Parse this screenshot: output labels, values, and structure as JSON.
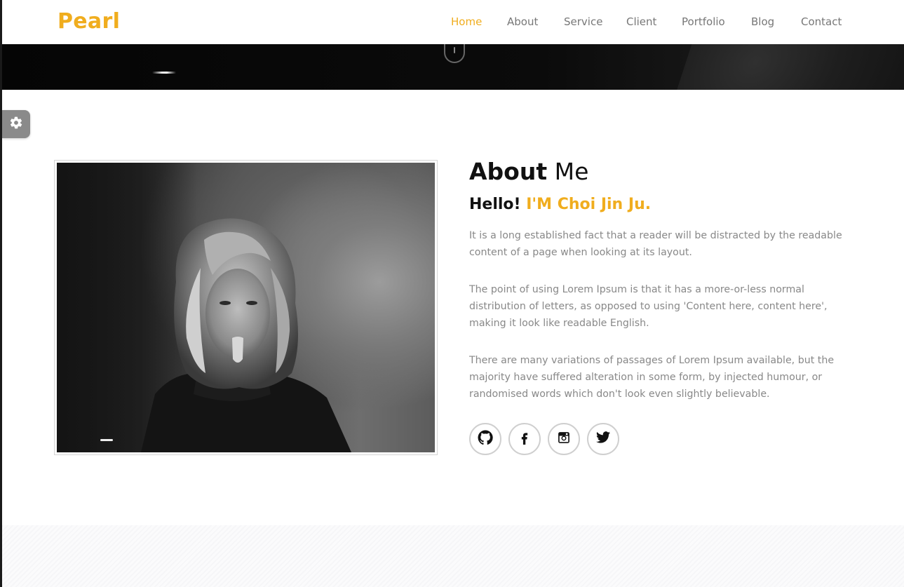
{
  "brand": {
    "name": "Pearl",
    "color": "#f0ad1e"
  },
  "nav": {
    "items": [
      {
        "label": "Home",
        "active": true
      },
      {
        "label": "About",
        "active": false
      },
      {
        "label": "Service",
        "active": false
      },
      {
        "label": "Client",
        "active": false
      },
      {
        "label": "Portfolio",
        "active": false
      },
      {
        "label": "Blog",
        "active": false
      },
      {
        "label": "Contact",
        "active": false
      }
    ]
  },
  "hero": {
    "scroll_icon": "mouse-scroll-icon"
  },
  "settings": {
    "icon": "gear-icon"
  },
  "about": {
    "title_bold": "About",
    "title_light": " Me",
    "hello": "Hello!",
    "name": "I'M Choi Jin Ju.",
    "paragraphs": [
      {
        "lines": [
          "It is a long established fact that a reader will be distracted by the readable",
          "content of a page when looking at its layout."
        ]
      },
      {
        "lines": [
          "The point of using Lorem Ipsum is that it has a more-or-less normal",
          "distribution of letters, as opposed to using 'Content here, content here',",
          "making it look like readable English."
        ]
      },
      {
        "lines": [
          "There are many variations of passages of Lorem Ipsum available, but the",
          "majority have suffered alteration in some form, by injected humour, or",
          "randomised words which don't look even slightly believable."
        ]
      }
    ],
    "social": [
      "github-icon",
      "facebook-icon",
      "instagram-icon",
      "twitter-icon"
    ]
  },
  "colors": {
    "accent": "#f0ad1e",
    "text_muted": "#888888",
    "heading": "#111111"
  }
}
